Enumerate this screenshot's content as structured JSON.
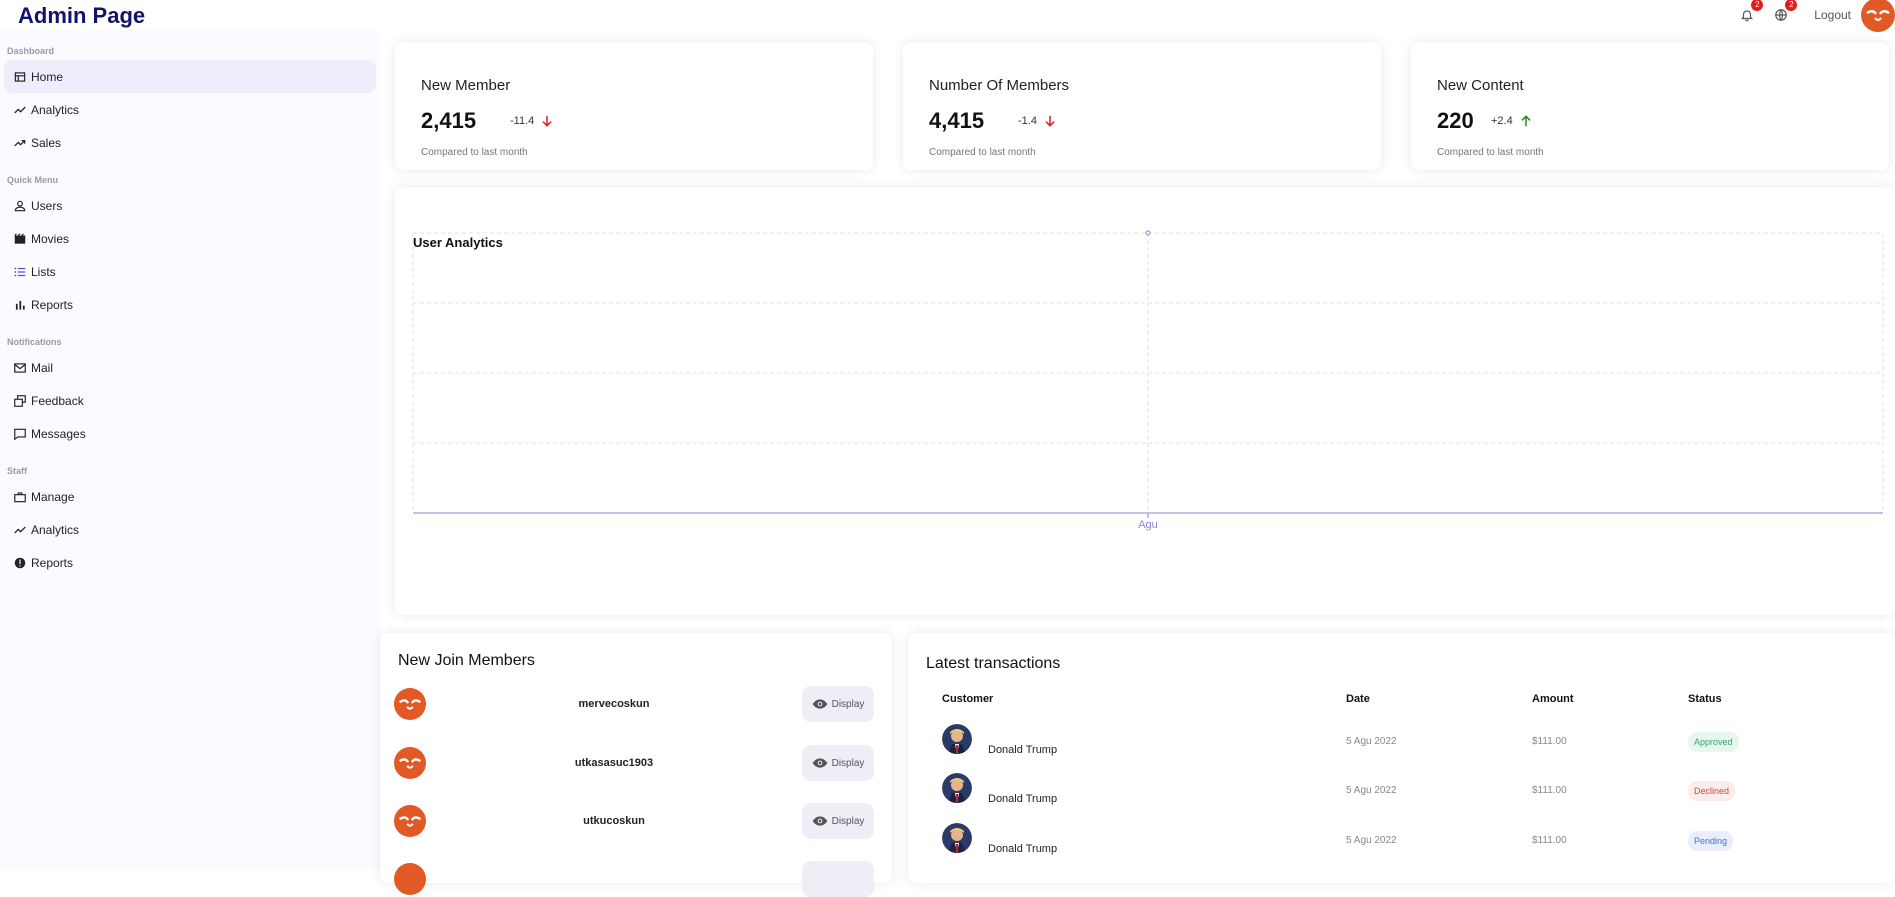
{
  "app": {
    "title": "Admin Page"
  },
  "topbar": {
    "notifications_count": "2",
    "language_count": "2",
    "logout_label": "Logout"
  },
  "sidebar": {
    "sections": [
      {
        "title": "Dashboard",
        "items": [
          {
            "label": "Home",
            "icon": "home-icon",
            "active": true
          },
          {
            "label": "Analytics",
            "icon": "timeline-icon"
          },
          {
            "label": "Sales",
            "icon": "trending-up-icon"
          }
        ]
      },
      {
        "title": "Quick Menu",
        "items": [
          {
            "label": "Users",
            "icon": "person-icon"
          },
          {
            "label": "Movies",
            "icon": "movie-icon"
          },
          {
            "label": "Lists",
            "icon": "list-icon"
          },
          {
            "label": "Reports",
            "icon": "bar-chart-icon"
          }
        ]
      },
      {
        "title": "Notifications",
        "items": [
          {
            "label": "Mail",
            "icon": "mail-icon"
          },
          {
            "label": "Feedback",
            "icon": "feedback-icon"
          },
          {
            "label": "Messages",
            "icon": "chat-icon"
          }
        ]
      },
      {
        "title": "Staff",
        "items": [
          {
            "label": "Manage",
            "icon": "briefcase-icon"
          },
          {
            "label": "Analytics",
            "icon": "timeline-icon"
          },
          {
            "label": "Reports",
            "icon": "report-icon"
          }
        ]
      }
    ]
  },
  "stats": [
    {
      "title": "New Member",
      "value": "2,415",
      "rate": "-11.4",
      "trend": "down",
      "subtitle": "Compared to last month"
    },
    {
      "title": "Number Of Members",
      "value": "4,415",
      "rate": "-1.4",
      "trend": "down",
      "subtitle": "Compared to last month"
    },
    {
      "title": "New Content",
      "value": "220",
      "rate": "+2.4",
      "trend": "up",
      "subtitle": "Compared to last month"
    }
  ],
  "analytics": {
    "title": "User Analytics"
  },
  "chart_data": {
    "type": "line",
    "title": "User Analytics",
    "categories": [
      "Agu"
    ],
    "series": [
      {
        "values": [
          4
        ]
      }
    ],
    "ylim": [
      0,
      4
    ],
    "grid": true,
    "line_color": "#8884d8"
  },
  "members": {
    "title": "New Join Members",
    "display_label": "Display",
    "list": [
      {
        "username": "mervecoskun"
      },
      {
        "username": "utkasasuc1903"
      },
      {
        "username": "utkucoskun"
      }
    ]
  },
  "transactions": {
    "title": "Latest transactions",
    "headers": {
      "customer": "Customer",
      "date": "Date",
      "amount": "Amount",
      "status": "Status"
    },
    "rows": [
      {
        "customer": "Donald Trump",
        "date": "5 Agu 2022",
        "amount": "$111.00",
        "status": "Approved"
      },
      {
        "customer": "Donald Trump",
        "date": "5 Agu 2022",
        "amount": "$111.00",
        "status": "Declined"
      },
      {
        "customer": "Donald Trump",
        "date": "5 Agu 2022",
        "amount": "$111.00",
        "status": "Pending"
      }
    ]
  },
  "colors": {
    "brand": "#13136e",
    "accent": "#e15a25",
    "down": "#e01c1c",
    "up": "#1b8a1b"
  }
}
